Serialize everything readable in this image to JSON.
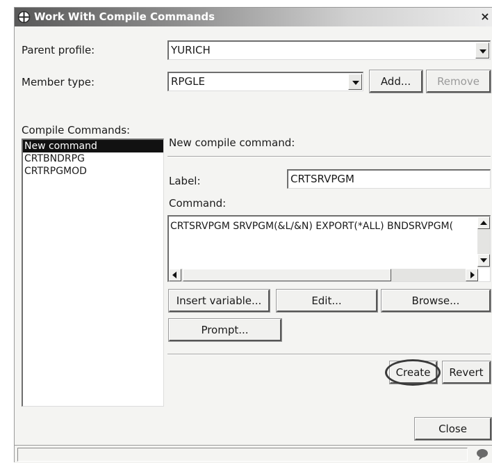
{
  "window": {
    "title": "Work With Compile Commands",
    "close_glyph": "×",
    "title_icon": "crosshair-circle-icon"
  },
  "parent_profile": {
    "label": "Parent profile:",
    "value": "YURICH"
  },
  "member_type": {
    "label": "Member type:",
    "value": "RPGLE",
    "add_label": "Add...",
    "remove_label": "Remove"
  },
  "compile_commands": {
    "label": "Compile Commands:",
    "items": [
      "New command",
      "CRTBNDRPG",
      "CRTRPGMOD"
    ],
    "selected_index": 0
  },
  "editor": {
    "heading": "New compile command:",
    "label_caption": "Label:",
    "label_value": "CRTSRVPGM",
    "command_caption": "Command:",
    "command_value": "CRTSRVPGM SRVPGM(&L/&N) EXPORT(*ALL) BNDSRVPGM(",
    "insert_variable_label": "Insert variable...",
    "edit_label": "Edit...",
    "browse_label": "Browse...",
    "prompt_label": "Prompt...",
    "create_label": "Create",
    "revert_label": "Revert"
  },
  "footer": {
    "close_label": "Close"
  },
  "colors": {
    "selection": "#111111",
    "highlight_ring": "#3a3a3a"
  }
}
